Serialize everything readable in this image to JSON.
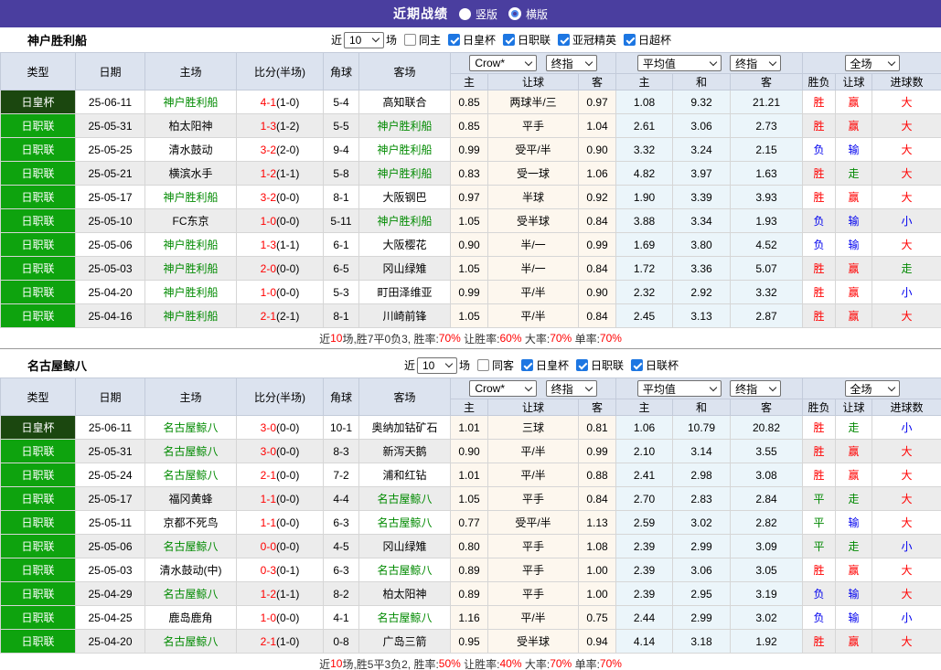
{
  "topbar": {
    "title": "近期战绩",
    "vertical": "竖版",
    "horizontal": "横版"
  },
  "colors": {
    "accent_purple": "#4A3E9F",
    "league_green": "#0EA30E",
    "cup_dark_green": "#1B470F",
    "win_red": "#FF0000",
    "draw_green": "#008800",
    "lose_blue": "#0000EE",
    "odds_bg": "#FDF7EE",
    "avg_bg": "#EBF5FA"
  },
  "styles": {
    "dark_type": "日皇杯"
  },
  "filter_labels": {
    "near": "近",
    "games": "场"
  },
  "table_header": {
    "cols": [
      "类型",
      "日期",
      "主场",
      "比分(半场)",
      "角球",
      "客场"
    ],
    "sub": [
      "主",
      "让球",
      "客",
      "主",
      "和",
      "客",
      "胜负",
      "让球",
      "进球数"
    ],
    "selects": {
      "odds_source": "Crow*",
      "odds_stage": "终指",
      "avg_source": "平均值",
      "avg_stage": "终指",
      "scope": "全场"
    }
  },
  "sections": [
    {
      "team": "神户胜利船",
      "filters": {
        "count": "10",
        "same": "同主",
        "same_checked": false,
        "leagues": [
          {
            "label": "日皇杯",
            "checked": true
          },
          {
            "label": "日职联",
            "checked": true
          },
          {
            "label": "亚冠精英",
            "checked": true
          },
          {
            "label": "日超杯",
            "checked": true
          }
        ]
      },
      "rows": [
        [
          "日皇杯",
          "25-06-11",
          "神户胜利船",
          "4-1",
          "(1-0)",
          "5-4",
          "高知联合",
          "0.85",
          "两球半/三",
          "0.97",
          "1.08",
          "9.32",
          "21.21",
          "胜",
          "赢",
          "大"
        ],
        [
          "日职联",
          "25-05-31",
          "柏太阳神",
          "1-3",
          "(1-2)",
          "5-5",
          "神户胜利船",
          "0.85",
          "平手",
          "1.04",
          "2.61",
          "3.06",
          "2.73",
          "胜",
          "赢",
          "大"
        ],
        [
          "日职联",
          "25-05-25",
          "清水鼓动",
          "3-2",
          "(2-0)",
          "9-4",
          "神户胜利船",
          "0.99",
          "受平/半",
          "0.90",
          "3.32",
          "3.24",
          "2.15",
          "负",
          "输",
          "大"
        ],
        [
          "日职联",
          "25-05-21",
          "横滨水手",
          "1-2",
          "(1-1)",
          "5-8",
          "神户胜利船",
          "0.83",
          "受一球",
          "1.06",
          "4.82",
          "3.97",
          "1.63",
          "胜",
          "走",
          "大"
        ],
        [
          "日职联",
          "25-05-17",
          "神户胜利船",
          "3-2",
          "(0-0)",
          "8-1",
          "大阪钢巴",
          "0.97",
          "半球",
          "0.92",
          "1.90",
          "3.39",
          "3.93",
          "胜",
          "赢",
          "大"
        ],
        [
          "日职联",
          "25-05-10",
          "FC东京",
          "1-0",
          "(0-0)",
          "5-11",
          "神户胜利船",
          "1.05",
          "受半球",
          "0.84",
          "3.88",
          "3.34",
          "1.93",
          "负",
          "输",
          "小"
        ],
        [
          "日职联",
          "25-05-06",
          "神户胜利船",
          "1-3",
          "(1-1)",
          "6-1",
          "大阪樱花",
          "0.90",
          "半/一",
          "0.99",
          "1.69",
          "3.80",
          "4.52",
          "负",
          "输",
          "大"
        ],
        [
          "日职联",
          "25-05-03",
          "神户胜利船",
          "2-0",
          "(0-0)",
          "6-5",
          "冈山绿雉",
          "1.05",
          "半/一",
          "0.84",
          "1.72",
          "3.36",
          "5.07",
          "胜",
          "赢",
          "走"
        ],
        [
          "日职联",
          "25-04-20",
          "神户胜利船",
          "1-0",
          "(0-0)",
          "5-3",
          "町田泽维亚",
          "0.99",
          "平/半",
          "0.90",
          "2.32",
          "2.92",
          "3.32",
          "胜",
          "赢",
          "小"
        ],
        [
          "日职联",
          "25-04-16",
          "神户胜利船",
          "2-1",
          "(2-1)",
          "8-1",
          "川崎前锋",
          "1.05",
          "平/半",
          "0.84",
          "2.45",
          "3.13",
          "2.87",
          "胜",
          "赢",
          "大"
        ]
      ],
      "summary": [
        {
          "t": "近"
        },
        {
          "t": "10",
          "red": true
        },
        {
          "t": "场,胜7平0负3, 胜率:"
        },
        {
          "t": "70%",
          "red": true
        },
        {
          "t": " 让胜率:"
        },
        {
          "t": "60%",
          "red": true
        },
        {
          "t": " 大率:"
        },
        {
          "t": "70%",
          "red": true
        },
        {
          "t": " 单率:"
        },
        {
          "t": "70%",
          "red": true
        }
      ]
    },
    {
      "team": "名古屋鲸八",
      "filters": {
        "count": "10",
        "same": "同客",
        "same_checked": false,
        "leagues": [
          {
            "label": "日皇杯",
            "checked": true
          },
          {
            "label": "日职联",
            "checked": true
          },
          {
            "label": "日联杯",
            "checked": true
          }
        ]
      },
      "rows": [
        [
          "日皇杯",
          "25-06-11",
          "名古屋鲸八",
          "3-0",
          "(0-0)",
          "10-1",
          "奥纳加钴矿石",
          "1.01",
          "三球",
          "0.81",
          "1.06",
          "10.79",
          "20.82",
          "胜",
          "走",
          "小"
        ],
        [
          "日职联",
          "25-05-31",
          "名古屋鲸八",
          "3-0",
          "(0-0)",
          "8-3",
          "新泻天鹅",
          "0.90",
          "平/半",
          "0.99",
          "2.10",
          "3.14",
          "3.55",
          "胜",
          "赢",
          "大"
        ],
        [
          "日职联",
          "25-05-24",
          "名古屋鲸八",
          "2-1",
          "(0-0)",
          "7-2",
          "浦和红钻",
          "1.01",
          "平/半",
          "0.88",
          "2.41",
          "2.98",
          "3.08",
          "胜",
          "赢",
          "大"
        ],
        [
          "日职联",
          "25-05-17",
          "福冈黄蜂",
          "1-1",
          "(0-0)",
          "4-4",
          "名古屋鲸八",
          "1.05",
          "平手",
          "0.84",
          "2.70",
          "2.83",
          "2.84",
          "平",
          "走",
          "大"
        ],
        [
          "日职联",
          "25-05-11",
          "京都不死鸟",
          "1-1",
          "(0-0)",
          "6-3",
          "名古屋鲸八",
          "0.77",
          "受平/半",
          "1.13",
          "2.59",
          "3.02",
          "2.82",
          "平",
          "输",
          "大"
        ],
        [
          "日职联",
          "25-05-06",
          "名古屋鲸八",
          "0-0",
          "(0-0)",
          "4-5",
          "冈山绿雉",
          "0.80",
          "平手",
          "1.08",
          "2.39",
          "2.99",
          "3.09",
          "平",
          "走",
          "小"
        ],
        [
          "日职联",
          "25-05-03",
          "清水鼓动(中)",
          "0-3",
          "(0-1)",
          "6-3",
          "名古屋鲸八",
          "0.89",
          "平手",
          "1.00",
          "2.39",
          "3.06",
          "3.05",
          "胜",
          "赢",
          "大"
        ],
        [
          "日职联",
          "25-04-29",
          "名古屋鲸八",
          "1-2",
          "(1-1)",
          "8-2",
          "柏太阳神",
          "0.89",
          "平手",
          "1.00",
          "2.39",
          "2.95",
          "3.19",
          "负",
          "输",
          "大"
        ],
        [
          "日职联",
          "25-04-25",
          "鹿岛鹿角",
          "1-0",
          "(0-0)",
          "4-1",
          "名古屋鲸八",
          "1.16",
          "平/半",
          "0.75",
          "2.44",
          "2.99",
          "3.02",
          "负",
          "输",
          "小"
        ],
        [
          "日职联",
          "25-04-20",
          "名古屋鲸八",
          "2-1",
          "(1-0)",
          "0-8",
          "广岛三箭",
          "0.95",
          "受半球",
          "0.94",
          "4.14",
          "3.18",
          "1.92",
          "胜",
          "赢",
          "大"
        ]
      ],
      "summary": [
        {
          "t": "近"
        },
        {
          "t": "10",
          "red": true
        },
        {
          "t": "场,胜5平3负2, 胜率:"
        },
        {
          "t": "50%",
          "red": true
        },
        {
          "t": " 让胜率:"
        },
        {
          "t": "40%",
          "red": true
        },
        {
          "t": " 大率:"
        },
        {
          "t": "70%",
          "red": true
        },
        {
          "t": " 单率:"
        },
        {
          "t": "70%",
          "red": true
        }
      ]
    }
  ]
}
